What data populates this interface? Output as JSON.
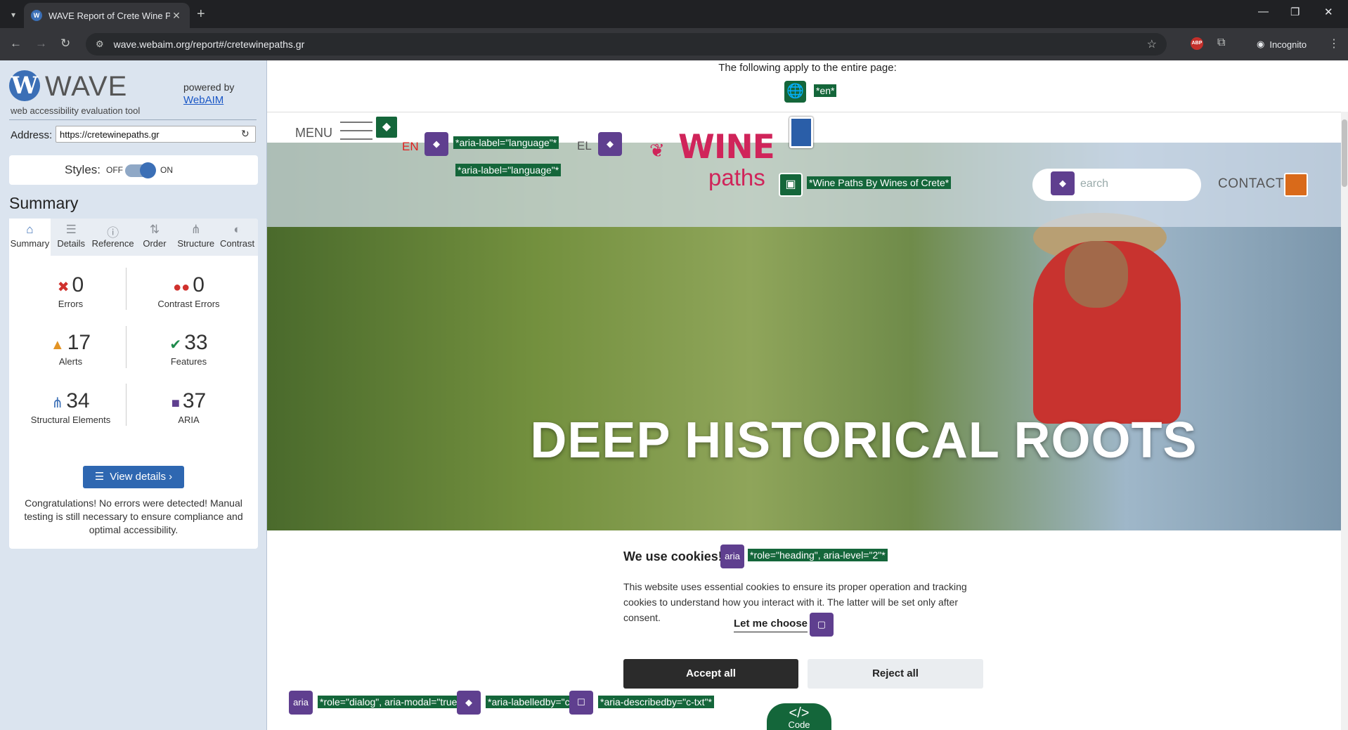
{
  "browser": {
    "tab_title": "WAVE Report of Crete Wine Pa",
    "url": "wave.webaim.org/report#/cretewinepaths.gr",
    "incognito_label": "Incognito",
    "abp_label": "ABP"
  },
  "wave": {
    "logo_letter": "W",
    "brand": "WAVE",
    "subtitle": "web accessibility evaluation tool",
    "powered_by": "powered by",
    "webaim_link": "WebAIM",
    "address_label": "Address:",
    "address_value": "https://cretewinepaths.gr",
    "styles_label": "Styles:",
    "styles_off": "OFF",
    "styles_on": "ON",
    "summary_title": "Summary",
    "tabs": [
      {
        "label": "Summary",
        "icon": "home-icon"
      },
      {
        "label": "Details",
        "icon": "list-icon"
      },
      {
        "label": "Reference",
        "icon": "info-icon"
      },
      {
        "label": "Order",
        "icon": "order-icon"
      },
      {
        "label": "Structure",
        "icon": "structure-icon"
      },
      {
        "label": "Contrast",
        "icon": "contrast-icon"
      }
    ],
    "stats": {
      "errors": {
        "value": "0",
        "label": "Errors"
      },
      "contrast_errors": {
        "value": "0",
        "label": "Contrast Errors"
      },
      "alerts": {
        "value": "17",
        "label": "Alerts"
      },
      "features": {
        "value": "33",
        "label": "Features"
      },
      "structural": {
        "value": "34",
        "label": "Structural Elements"
      },
      "aria": {
        "value": "37",
        "label": "ARIA"
      }
    },
    "view_details": "View details ›",
    "congrats": "Congratulations! No errors were detected! Manual testing is still necessary to ensure compliance and optimal accessibility."
  },
  "page": {
    "applies_text": "The following apply to the entire page:",
    "lang_tag": "*en*",
    "menu_label": "MENU",
    "lang_en": "EN",
    "lang_el": "EL",
    "aria_label_language": "*aria-label=\"language\"*",
    "logo_wine": "WINE",
    "logo_paths": "paths",
    "logo_alt": "*Wine Paths By Wines of Crete*",
    "search_placeholder": "earch",
    "contact_label": "CONTACT",
    "headline": "DEEP HISTORICAL ROOTS",
    "cookie_heading": "We use cookies!",
    "aria_badge": "aria",
    "cookie_heading_tag": "*role=\"heading\", aria-level=\"2\"*",
    "cookie_text": "This website uses essential cookies to ensure its proper operation and tracking cookies to understand how you interact with it. The latter will be set only after consent.",
    "let_me_choose": "Let me choose",
    "accept_all": "Accept all",
    "reject_all": "Reject all",
    "dialog_tag": "*role=\"dialog\", aria-modal=\"true\"*",
    "labelledby_tag": "*aria-labelledby=\"c-ttl\"*",
    "describedby_tag": "*aria-describedby=\"c-txt\"*",
    "code_symbol": "</>",
    "code_label": "Code"
  }
}
